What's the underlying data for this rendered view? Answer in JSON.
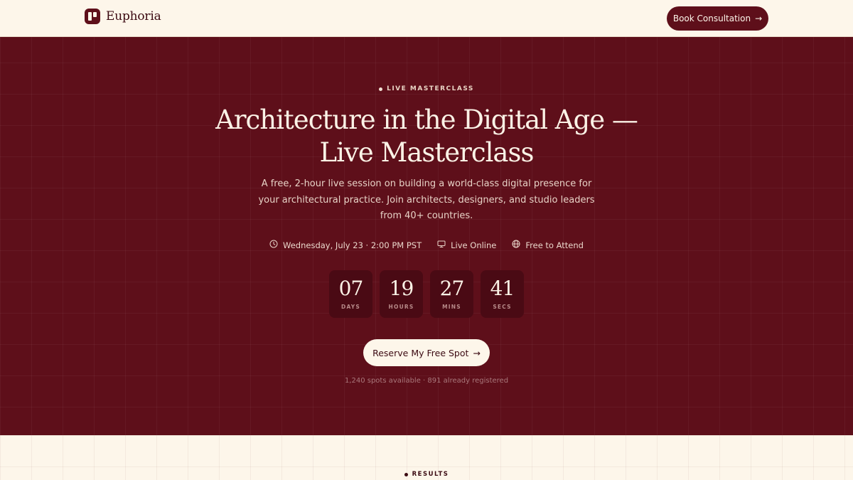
{
  "header": {
    "brand": "Euphoria",
    "cta_label": "Book Consultation",
    "cta_arrow": "→"
  },
  "hero": {
    "eyebrow": "LIVE MASTERCLASS",
    "title_line1": "Architecture in the Digital Age —",
    "title_line2": "Live Masterclass",
    "subtitle": "A free, 2-hour live session on building a world-class digital presence for your architectural practice. Join architects, designers, and studio leaders from 40+ countries.",
    "meta": [
      {
        "icon": "clock-icon",
        "label": "Wednesday, July 23 · 2:00 PM PST"
      },
      {
        "icon": "monitor-icon",
        "label": "Live Online"
      },
      {
        "icon": "globe-icon",
        "label": "Free to Attend"
      }
    ],
    "countdown": [
      {
        "value": "07",
        "label": "DAYS"
      },
      {
        "value": "19",
        "label": "HOURS"
      },
      {
        "value": "27",
        "label": "MINS"
      },
      {
        "value": "41",
        "label": "SECS"
      }
    ],
    "cta_label": "Reserve My Free Spot",
    "cta_arrow": "→",
    "spots_text": "1,240 spots available · 891 already registered"
  },
  "results": {
    "eyebrow": "RESULTS"
  },
  "colors": {
    "brand": "#5E0F1A",
    "cream": "#FDF6EA",
    "countdown_box": "#4A0A14"
  }
}
